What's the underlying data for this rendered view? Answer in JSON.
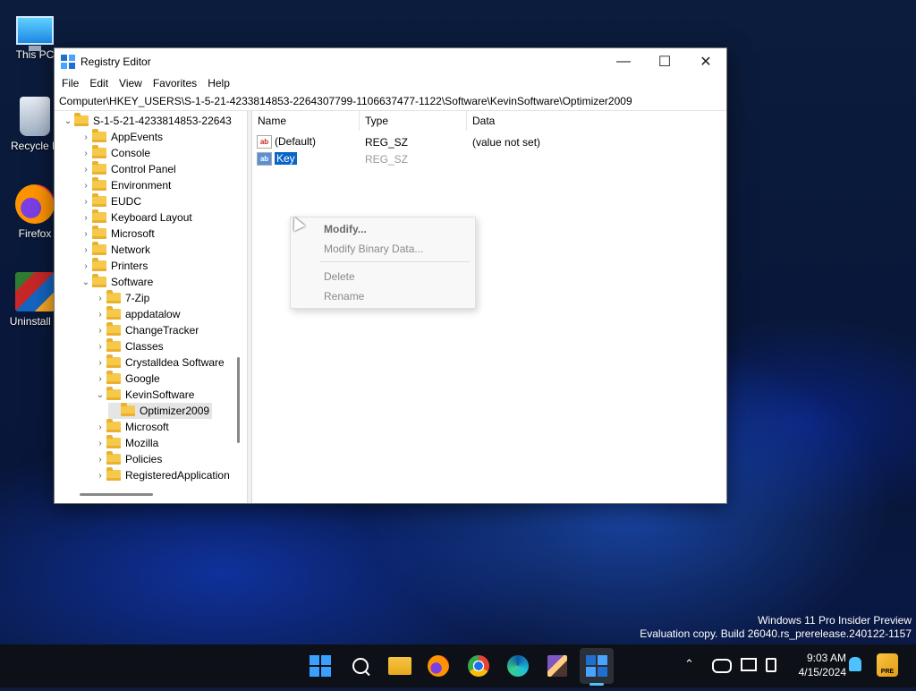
{
  "desktop": {
    "icons": [
      {
        "label": "This PC",
        "icon": "computer-icon"
      },
      {
        "label": "Recycle B",
        "icon": "recycle-bin-icon"
      },
      {
        "label": "Firefox",
        "icon": "firefox-icon"
      },
      {
        "label": "Uninstall T",
        "icon": "uninstall-tool-icon"
      }
    ],
    "watermark": {
      "line1": "Windows 11 Pro Insider Preview",
      "line2": "Evaluation copy. Build 26040.rs_prerelease.240122-1157"
    }
  },
  "window": {
    "title": "Registry Editor",
    "controls": {
      "minimize": "—",
      "maximize": "☐",
      "close": "✕"
    },
    "menu": [
      "File",
      "Edit",
      "View",
      "Favorites",
      "Help"
    ],
    "address": "Computer\\HKEY_USERS\\S-1-5-21-4233814853-2264307799-1106637477-1122\\Software\\KevinSoftware\\Optimizer2009",
    "tree": [
      {
        "label": "S-1-5-21-4233814853-22643",
        "chevron": "⌄"
      },
      {
        "label": "AppEvents",
        "chevron": "›"
      },
      {
        "label": "Console",
        "chevron": "›"
      },
      {
        "label": "Control Panel",
        "chevron": "›"
      },
      {
        "label": "Environment",
        "chevron": "›"
      },
      {
        "label": "EUDC",
        "chevron": "›"
      },
      {
        "label": "Keyboard Layout",
        "chevron": "›"
      },
      {
        "label": "Microsoft",
        "chevron": "›"
      },
      {
        "label": "Network",
        "chevron": "›"
      },
      {
        "label": "Printers",
        "chevron": "›"
      },
      {
        "label": "Software",
        "chevron": "⌄"
      },
      {
        "label": "7-Zip",
        "chevron": "›"
      },
      {
        "label": "appdatalow",
        "chevron": "›"
      },
      {
        "label": "ChangeTracker",
        "chevron": "›"
      },
      {
        "label": "Classes",
        "chevron": "›"
      },
      {
        "label": "Crystalldea Software",
        "chevron": "›"
      },
      {
        "label": "Google",
        "chevron": "›"
      },
      {
        "label": "KevinSoftware",
        "chevron": "⌄"
      },
      {
        "label": "Optimizer2009",
        "chevron": ""
      },
      {
        "label": "Microsoft",
        "chevron": "›"
      },
      {
        "label": "Mozilla",
        "chevron": "›"
      },
      {
        "label": "Policies",
        "chevron": "›"
      },
      {
        "label": "RegisteredApplication",
        "chevron": "›"
      }
    ],
    "columns": {
      "name": "Name",
      "type": "Type",
      "data": "Data"
    },
    "values": [
      {
        "icon_text": "ab",
        "name": "(Default)",
        "type": "REG_SZ",
        "data": "(value not set)"
      },
      {
        "icon_text": "ab",
        "name": "Key",
        "type": "REG_SZ",
        "data": ""
      }
    ],
    "context_menu": {
      "modify": "Modify...",
      "modify_binary": "Modify Binary Data...",
      "delete": "Delete",
      "rename": "Rename"
    }
  },
  "taskbar": {
    "apps": [
      "start-icon",
      "search-icon",
      "file-explorer-icon",
      "firefox-icon",
      "chrome-icon",
      "edge-icon",
      "app-icon",
      "registry-editor-icon"
    ],
    "tray": {
      "chevron": "⌃",
      "time": "9:03 AM",
      "date": "4/15/2024",
      "badge": "PRE"
    }
  },
  "colors": {
    "selection": "#0a64c8",
    "accent": "#4cc2ff"
  }
}
